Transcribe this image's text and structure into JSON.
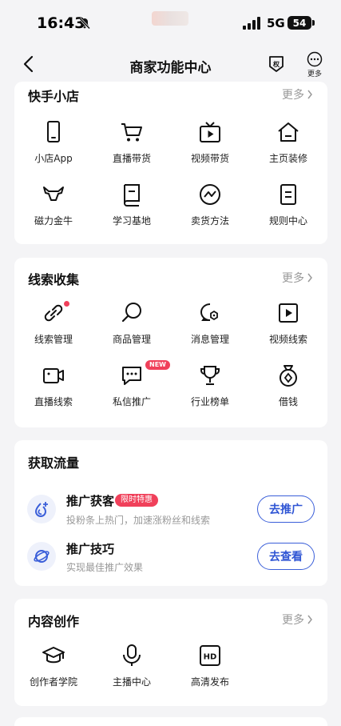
{
  "status_bar": {
    "time": "16:43",
    "network": "5G",
    "battery": "54"
  },
  "nav": {
    "title": "商家功能中心",
    "shield_label": "权",
    "more_label": "更多"
  },
  "sections": {
    "shop": {
      "title": "快手小店",
      "more": "更多",
      "items": [
        {
          "label": "小店App",
          "icon": "phone-icon"
        },
        {
          "label": "直播带货",
          "icon": "cart-icon"
        },
        {
          "label": "视频带货",
          "icon": "tv-icon"
        },
        {
          "label": "主页装修",
          "icon": "home-icon"
        },
        {
          "label": "磁力金牛",
          "icon": "bull-icon"
        },
        {
          "label": "学习基地",
          "icon": "book-icon"
        },
        {
          "label": "卖货方法",
          "icon": "trend-icon"
        },
        {
          "label": "规则中心",
          "icon": "doc-icon"
        }
      ]
    },
    "leads": {
      "title": "线索收集",
      "more": "更多",
      "items": [
        {
          "label": "线索管理",
          "icon": "link-icon"
        },
        {
          "label": "商品管理",
          "icon": "search-icon"
        },
        {
          "label": "消息管理",
          "icon": "chat-gear-icon"
        },
        {
          "label": "视频线索",
          "icon": "play-icon"
        },
        {
          "label": "直播线索",
          "icon": "camera-icon"
        },
        {
          "label": "私信推广",
          "icon": "message-icon",
          "badge": "NEW"
        },
        {
          "label": "行业榜单",
          "icon": "trophy-icon"
        },
        {
          "label": "借钱",
          "icon": "money-bag-icon"
        }
      ]
    },
    "traffic": {
      "title": "获取流量",
      "rows": [
        {
          "title": "推广获客",
          "tag": "限时特惠",
          "subtitle": "投粉条上热门，加速涨粉丝和线索",
          "button": "去推广"
        },
        {
          "title": "推广技巧",
          "subtitle": "实现最佳推广效果",
          "button": "去查看"
        }
      ]
    },
    "content": {
      "title": "内容创作",
      "more": "更多",
      "items": [
        {
          "label": "创作者学院",
          "icon": "graduation-cap-icon"
        },
        {
          "label": "主播中心",
          "icon": "microphone-icon"
        },
        {
          "label": "高清发布",
          "icon": "hd-icon",
          "glyph": "HD"
        }
      ]
    }
  },
  "colors": {
    "accent": "#2f55d4",
    "badge": "#f0405a",
    "background": "#f4f4f6"
  }
}
